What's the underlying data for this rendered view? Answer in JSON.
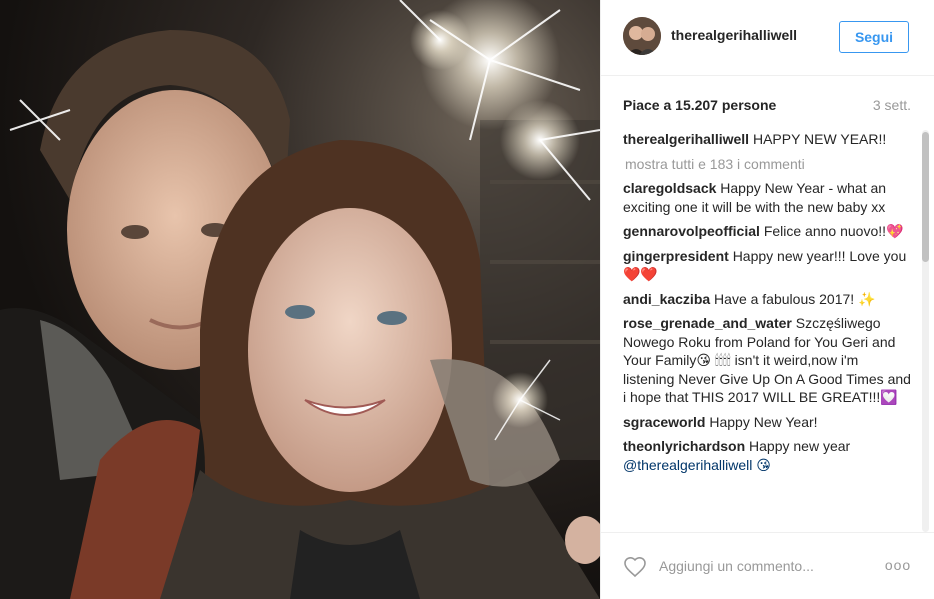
{
  "header": {
    "username": "therealgerihalliwell",
    "follow_label": "Segui"
  },
  "post": {
    "likes": "Piace a 15.207 persone",
    "time": "3 sett."
  },
  "caption": {
    "user": "therealgerihalliwell",
    "text": "HAPPY NEW YEAR!!"
  },
  "show_all": "mostra tutti e 183 i commenti",
  "comments": [
    {
      "user": "claregoldsack",
      "text": "Happy New Year - what an exciting one it will be with the new baby xx"
    },
    {
      "user": "gennarovolpeofficial",
      "text": "Felice anno nuovo!!💖"
    },
    {
      "user": "gingerpresident",
      "text": "Happy new year!!! Love you ❤️❤️"
    },
    {
      "user": "andi_kacziba",
      "text": "Have a fabulous 2017! ✨"
    },
    {
      "user": "rose_grenade_and_water",
      "text": "Szczęśliwego Nowego Roku from Poland for You Geri and Your Family😘 🕯🕯🕯🕯 isn't it weird,now i'm listening Never Give Up On A Good Times and i hope that THIS 2017 WILL BE GREAT!!!💟"
    },
    {
      "user": "sgraceworld",
      "text": "Happy New Year!"
    },
    {
      "user": "theonlyrichardson",
      "text": "Happy new year",
      "mention": "@therealgerihalliwell 😘"
    }
  ],
  "footer": {
    "comment_placeholder": "Aggiungi un commento...",
    "more_label": "ooo"
  },
  "colors": {
    "accent": "#3897f0",
    "text": "#262626",
    "muted": "#999999",
    "border": "#efefef"
  },
  "icons": [
    "heart-icon",
    "more-options-icon"
  ]
}
